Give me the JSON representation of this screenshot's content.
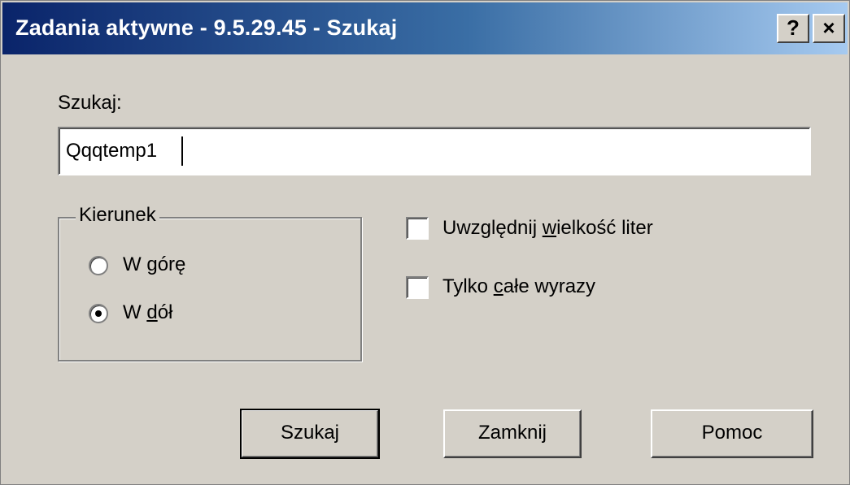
{
  "window": {
    "title": "Zadania aktywne - 9.5.29.45 - Szukaj",
    "help_button": "?",
    "close_button": "×"
  },
  "search": {
    "label": "Szukaj:",
    "value": "Qqqtemp1"
  },
  "direction": {
    "group_title": "Kierunek",
    "options": [
      {
        "pre": "W ",
        "accel": "g",
        "post": "órę",
        "selected": false
      },
      {
        "pre": "W ",
        "accel": "d",
        "post": "ół",
        "selected": true
      }
    ]
  },
  "options": {
    "match_case": {
      "pre": "Uwzględnij ",
      "accel": "w",
      "post": "ielkość liter",
      "checked": false
    },
    "whole_words": {
      "pre": "Tylko ",
      "accel": "c",
      "post": "ałe wyrazy",
      "checked": false
    }
  },
  "buttons": {
    "search": "Szukaj",
    "close": "Zamknij",
    "help": "Pomoc"
  },
  "colors": {
    "title_gradient_start": "#0a246a",
    "title_gradient_end": "#a6caf0",
    "dialog_face": "#d4d0c8"
  }
}
